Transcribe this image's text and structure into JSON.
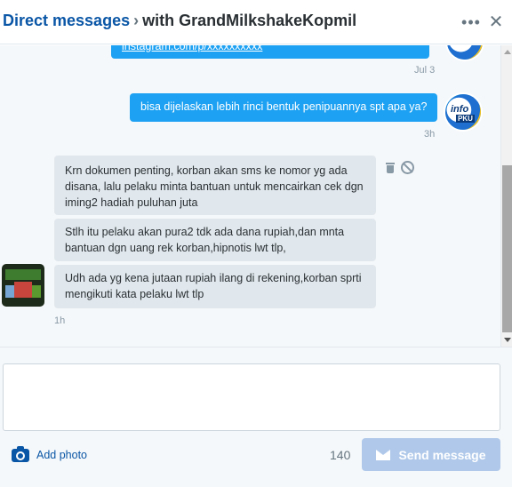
{
  "header": {
    "title_main": "Direct messages",
    "title_sep": "›",
    "title_with": "with GrandMilkshakeKopmil",
    "more_icon": "•••",
    "close_icon": "✕"
  },
  "thread": {
    "messages": [
      {
        "direction": "sent",
        "text": "instagram.com/p/xxxxxxxxxx",
        "time": "Jul 3"
      },
      {
        "direction": "sent",
        "text": "bisa dijelaskan lebih rinci bentuk penipuannya spt apa ya?",
        "time": "3h"
      },
      {
        "direction": "received",
        "text": "Krn dokumen penting, korban akan sms ke nomor yg ada disana, lalu pelaku minta bantuan untuk mencairkan cek dgn iming2 hadiah puluhan juta"
      },
      {
        "direction": "received",
        "text": "Stlh itu pelaku akan pura2 tdk ada dana rupiah,dan mnta bantuan dgn uang rek korban,hipnotis lwt tlp,"
      },
      {
        "direction": "received",
        "text": "Udh ada yg kena jutaan rupiah ilang di rekening,korban sprti mengikuti kata pelaku lwt tlp",
        "time": "1h"
      }
    ],
    "avatars": {
      "self_label": "info",
      "self_sub": "PKU"
    }
  },
  "composer": {
    "value": "",
    "placeholder": ""
  },
  "footer": {
    "add_photo_label": "Add photo",
    "char_count": "140",
    "send_label": "Send message"
  },
  "colors": {
    "accent": "#1da1f2",
    "link": "#0a56a6",
    "send_disabled": "#b0c9ea",
    "bubble_in": "#e1e8ed"
  }
}
